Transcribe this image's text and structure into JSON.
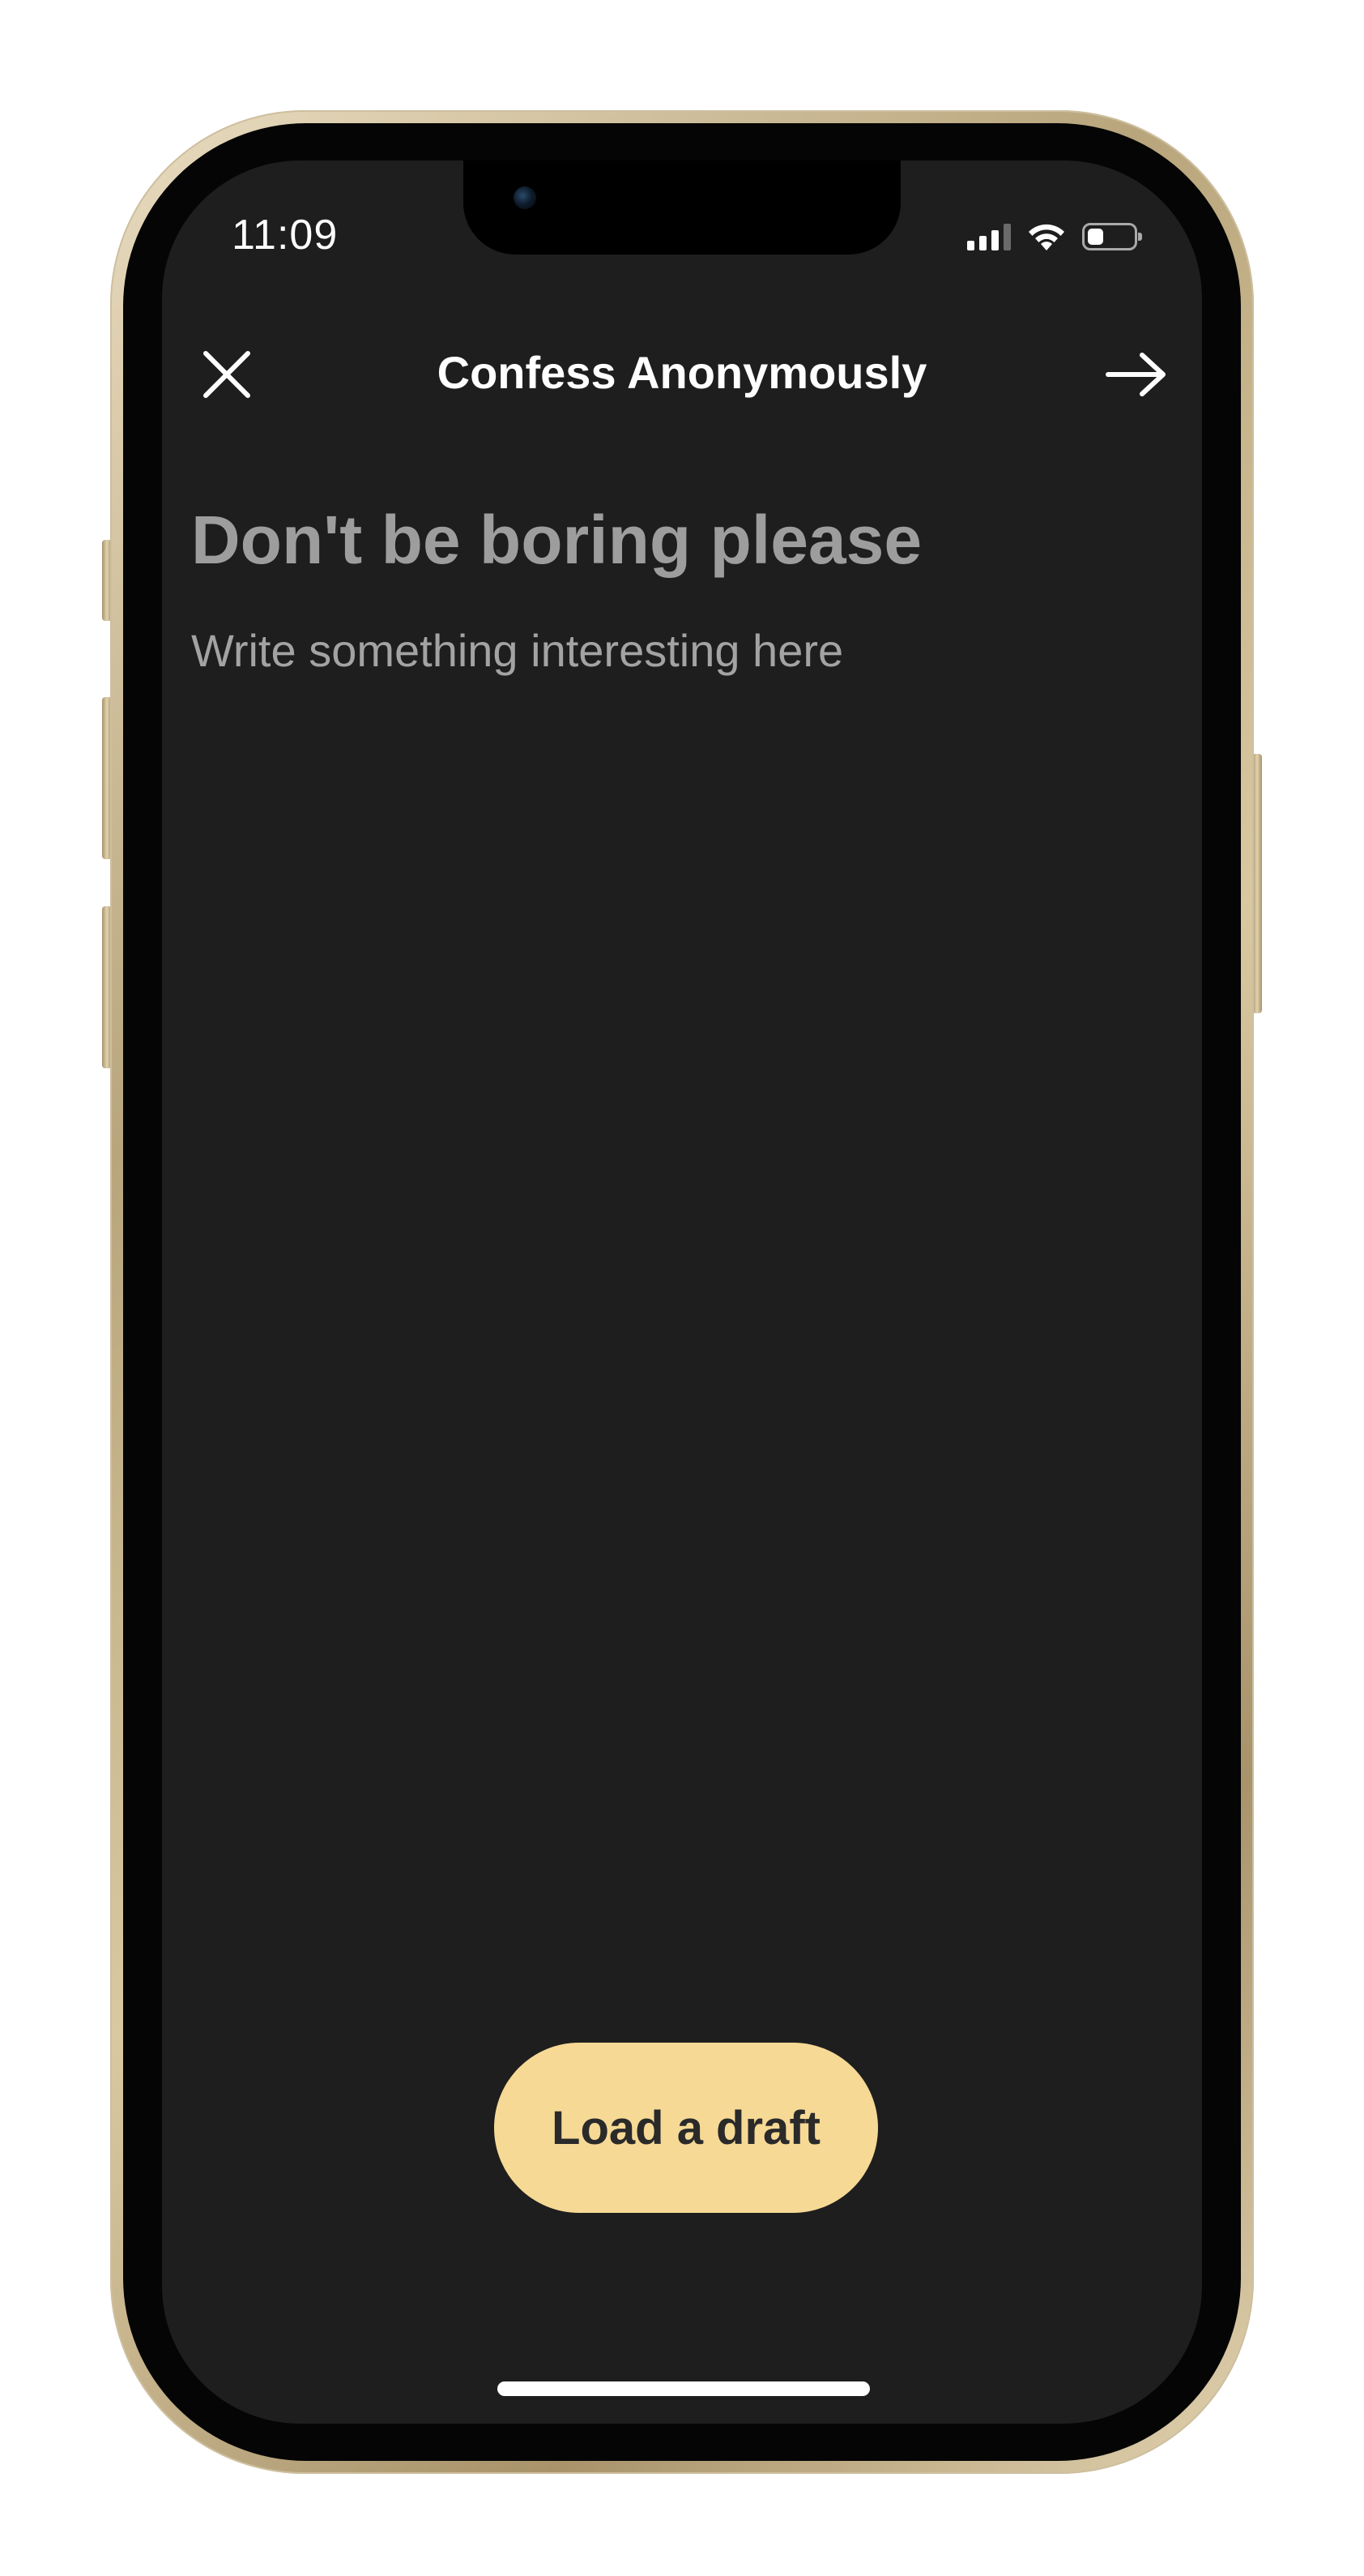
{
  "status_bar": {
    "time": "11:09",
    "icons": [
      "signal-icon",
      "wifi-icon",
      "battery-icon"
    ],
    "battery_level": 0.35
  },
  "header": {
    "title": "Confess Anonymously",
    "close_icon": "close-icon",
    "next_icon": "arrow-right-icon"
  },
  "compose": {
    "title_placeholder": "Don't be boring please",
    "body_placeholder": "Write something interesting here"
  },
  "actions": {
    "load_draft_label": "Load a draft"
  },
  "colors": {
    "screen_background": "#1e1e1e",
    "accent": "#f6d995",
    "placeholder": "#9d9d9d",
    "text_primary": "#ffffff"
  }
}
